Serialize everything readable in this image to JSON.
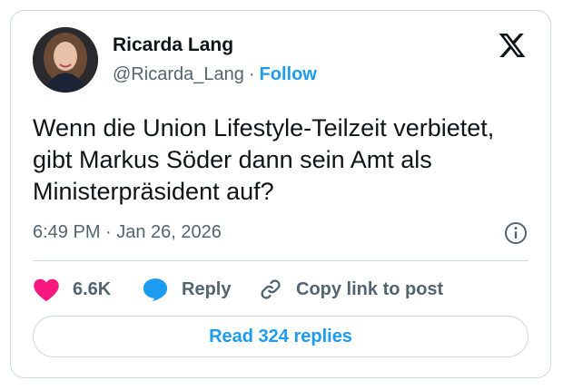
{
  "author": {
    "name": "Ricarda Lang",
    "handle": "@Ricarda_Lang",
    "separator": "·",
    "follow_label": "Follow"
  },
  "tweet": {
    "text": "Wenn die Union Lifestyle-Teilzeit verbietet, gibt Markus Söder dann sein Amt als Ministerpräsident auf?",
    "timestamp": "6:49 PM · Jan 26, 2026"
  },
  "actions": {
    "like_count": "6.6K",
    "reply_label": "Reply",
    "copy_label": "Copy link to post"
  },
  "read_replies_label": "Read 324 replies",
  "icons": [
    "x-logo-icon",
    "info-icon",
    "heart-icon",
    "reply-icon",
    "link-icon"
  ],
  "colors": {
    "accent": "#1d9bf0",
    "like": "#f91880",
    "muted": "#536471",
    "border": "#cfd9de"
  }
}
